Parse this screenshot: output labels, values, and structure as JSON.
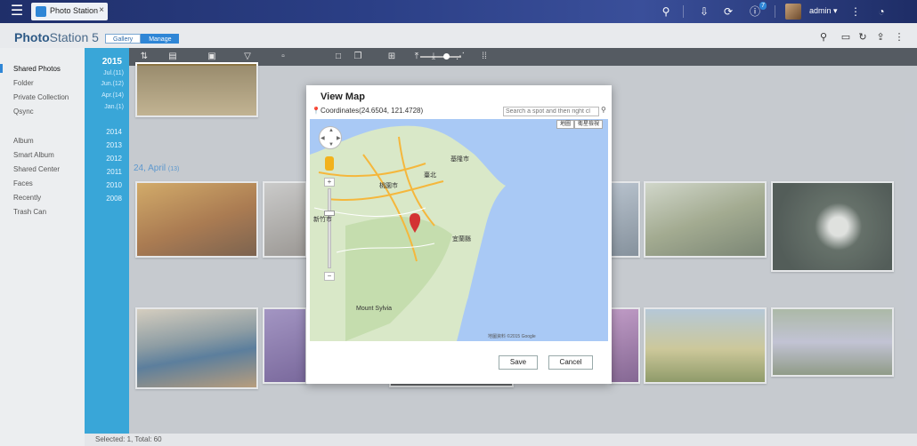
{
  "topbar": {
    "tab_label": "Photo Station",
    "tab_close": "×",
    "notification_count": "7",
    "user": "admin ▾"
  },
  "header": {
    "title_bold": "Photo",
    "title_rest": "Station 5",
    "modes": [
      "Gallery",
      "Manage"
    ]
  },
  "sidebar": {
    "items": [
      "Shared Photos",
      "Folder",
      "Private Collection",
      "Qsync",
      "Album",
      "Smart Album",
      "Shared Center",
      "Faces",
      "Recently",
      "Trash Can"
    ]
  },
  "timeline": {
    "current_year": "2015",
    "months": [
      "Jul.(11)",
      "Jun.(12)",
      "Apr.(14)",
      "Jan.(1)"
    ],
    "years": [
      "2014",
      "2013",
      "2012",
      "2011",
      "2010",
      "2008"
    ]
  },
  "content": {
    "date_group_label": "24, April",
    "date_group_count": "(13)"
  },
  "status": {
    "text": "Selected: 1, Total: 60"
  },
  "modal": {
    "title": "View Map",
    "coordinates": "Coordinates(24.6504, 121.4728)",
    "search_placeholder": "Search a spot and then right cl",
    "map_types": [
      "地圖",
      "衛星檢視"
    ],
    "labels": {
      "keelung": "基隆市",
      "taipei": "臺北",
      "taoyuan": "桃園市",
      "hsinchu": "新竹市",
      "yilan": "宜蘭縣",
      "mt_sylvia": "Mount Sylvia"
    },
    "attribution": "地圖資料 ©2015 Google",
    "save": "Save",
    "cancel": "Cancel"
  },
  "colors": {
    "accent": "#2f86d6",
    "timeline": "#39a6d8",
    "toolbar": "#555b62",
    "map_sea": "#a9c9f5",
    "map_land": "#d9e8c8",
    "pin": "#d33333"
  }
}
